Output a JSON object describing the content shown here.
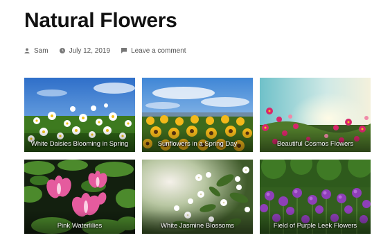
{
  "post": {
    "title": "Natural Flowers",
    "meta": {
      "author": "Sam",
      "date": "July 12, 2019",
      "comments_link": "Leave a comment",
      "icons": [
        "user-icon",
        "clock-icon",
        "comment-icon"
      ]
    }
  },
  "gallery": {
    "columns": 3,
    "items": [
      {
        "caption": "White Daisies Blooming in Spring",
        "image": "white-daisies-photo"
      },
      {
        "caption": "Sunflowers in a Spring Day",
        "image": "sunflowers-photo"
      },
      {
        "caption": "Beautiful Cosmos Flowers",
        "image": "cosmos-flowers-photo"
      },
      {
        "caption": "Pink Waterlilies",
        "image": "pink-waterlilies-photo"
      },
      {
        "caption": "White Jasmine Blossoms",
        "image": "white-jasmine-photo"
      },
      {
        "caption": "Field of Purple Leek Flowers",
        "image": "purple-leek-photo"
      }
    ]
  }
}
